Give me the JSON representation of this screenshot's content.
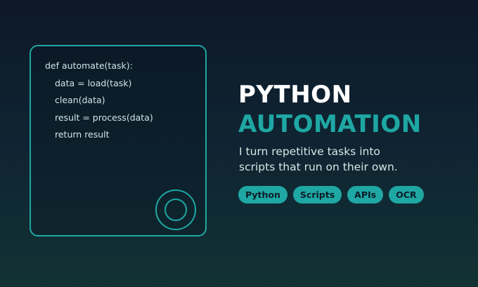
{
  "code": {
    "lines": [
      "def automate(task):",
      "data = load(task)",
      "clean(data)",
      "result = process(data)",
      "return result"
    ]
  },
  "heading": {
    "line1": "PYTHON",
    "line2": "AUTOMATION"
  },
  "tagline": {
    "line1": "I turn repetitive tasks into",
    "line2": "scripts that run on their own."
  },
  "tags": [
    "Python",
    "Scripts",
    "APIs",
    "OCR"
  ],
  "colors": {
    "accent": "#1fa7a4",
    "heading": "#ffffff",
    "body_text": "#d6e6e6"
  }
}
